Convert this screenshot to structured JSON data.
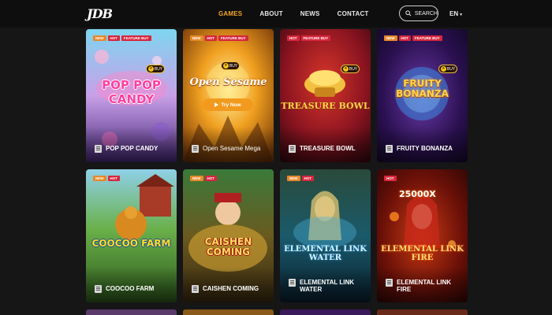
{
  "header": {
    "logo": "JDB",
    "nav": [
      {
        "label": "GAMES",
        "active": true
      },
      {
        "label": "ABOUT",
        "active": false
      },
      {
        "label": "NEWS",
        "active": false
      },
      {
        "label": "CONTACT",
        "active": false
      }
    ],
    "search_label": "SEARCH",
    "language": "EN"
  },
  "colors": {
    "accent": "#f5a623",
    "background": "#161616",
    "badge_new": "#e6892b",
    "badge_hot": "#d7263d"
  },
  "badge_labels": {
    "new": "NEW",
    "hot": "HOT",
    "feature_buy": "FEATURE BUY",
    "buy": "BUY",
    "try_now": "Try Now"
  },
  "games": [
    {
      "name": "POP POP CANDY",
      "art_title": "POP POP CANDY",
      "badges": [
        "NEW",
        "HOT",
        "FEATURE BUY"
      ]
    },
    {
      "name": "Open Sesame Mega",
      "art_title": "Open Sesame",
      "badges": [
        "NEW",
        "HOT",
        "FEATURE BUY"
      ]
    },
    {
      "name": "TREASURE BOWL",
      "art_title": "TREASURE BOWL",
      "badges": [
        "HOT",
        "FEATURE BUY"
      ]
    },
    {
      "name": "FRUITY BONANZA",
      "art_title": "FRUITY BONANZA",
      "badges": [
        "NEW",
        "HOT",
        "FEATURE BUY"
      ]
    },
    {
      "name": "COOCOO FARM",
      "art_title": "COOCOO FARM",
      "badges": [
        "NEW",
        "HOT"
      ]
    },
    {
      "name": "CAISHEN COMING",
      "art_title": "CAISHEN COMING",
      "badges": [
        "NEW",
        "HOT"
      ]
    },
    {
      "name": "ELEMENTAL LINK WATER",
      "art_title": "ELEMENTAL LINK WATER",
      "badges": [
        "NEW",
        "HOT"
      ]
    },
    {
      "name": "ELEMENTAL LINK FIRE",
      "art_title": "ELEMENTAL LINK FIRE",
      "multiplier": "25000X",
      "badges": [
        "HOT"
      ]
    }
  ]
}
